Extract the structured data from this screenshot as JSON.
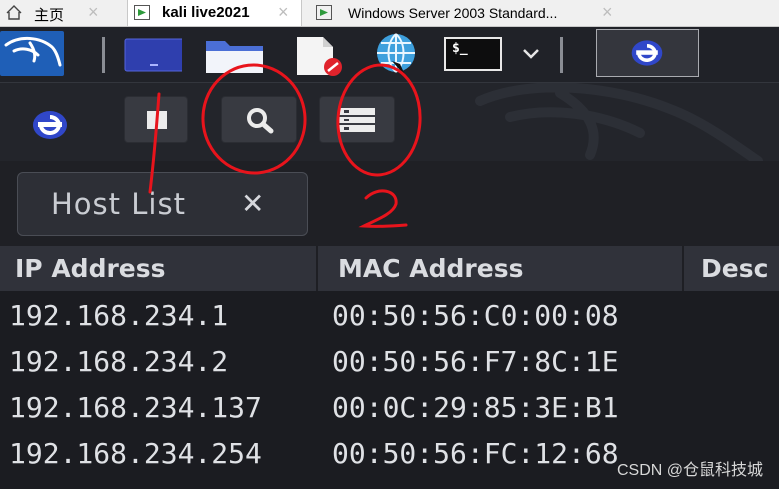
{
  "browser_tabs": [
    {
      "label": "主页",
      "icon": "home-icon",
      "active": false
    },
    {
      "label": "kali live2021",
      "icon": "vm-icon",
      "active": true
    },
    {
      "label": "Windows Server 2003 Standard...",
      "icon": "vm-icon",
      "active": false
    }
  ],
  "panel": {
    "icons": [
      "kali-dragon-icon",
      "workspace-icon",
      "file-manager-icon",
      "text-editor-icon",
      "web-browser-icon",
      "terminal-icon",
      "chevron-down-icon",
      "ettercap-icon"
    ],
    "terminal_glyph": "$_"
  },
  "toolbar": {
    "buttons": [
      "stop-icon",
      "search-icon",
      "hosts-list-icon"
    ]
  },
  "host_list_tab": {
    "label": "Host List",
    "close_glyph": "✕"
  },
  "table": {
    "columns": [
      "IP Address",
      "MAC Address",
      "Desc"
    ],
    "rows": [
      {
        "ip": "192.168.234.1",
        "mac": "00:50:56:C0:00:08"
      },
      {
        "ip": "192.168.234.2",
        "mac": "00:50:56:F7:8C:1E"
      },
      {
        "ip": "192.168.234.137",
        "mac": "00:0C:29:85:3E:B1"
      },
      {
        "ip": "192.168.234.254",
        "mac": "00:50:56:FC:12:68"
      }
    ]
  },
  "annotations": {
    "labels": [
      "1",
      "2"
    ],
    "color": "#e8141c"
  },
  "watermark": "CSDN @仓鼠科技城",
  "colors": {
    "kali_blue": "#1f5fb7",
    "ie_blue": "#3047c9",
    "annotation_red": "#e8141c"
  }
}
